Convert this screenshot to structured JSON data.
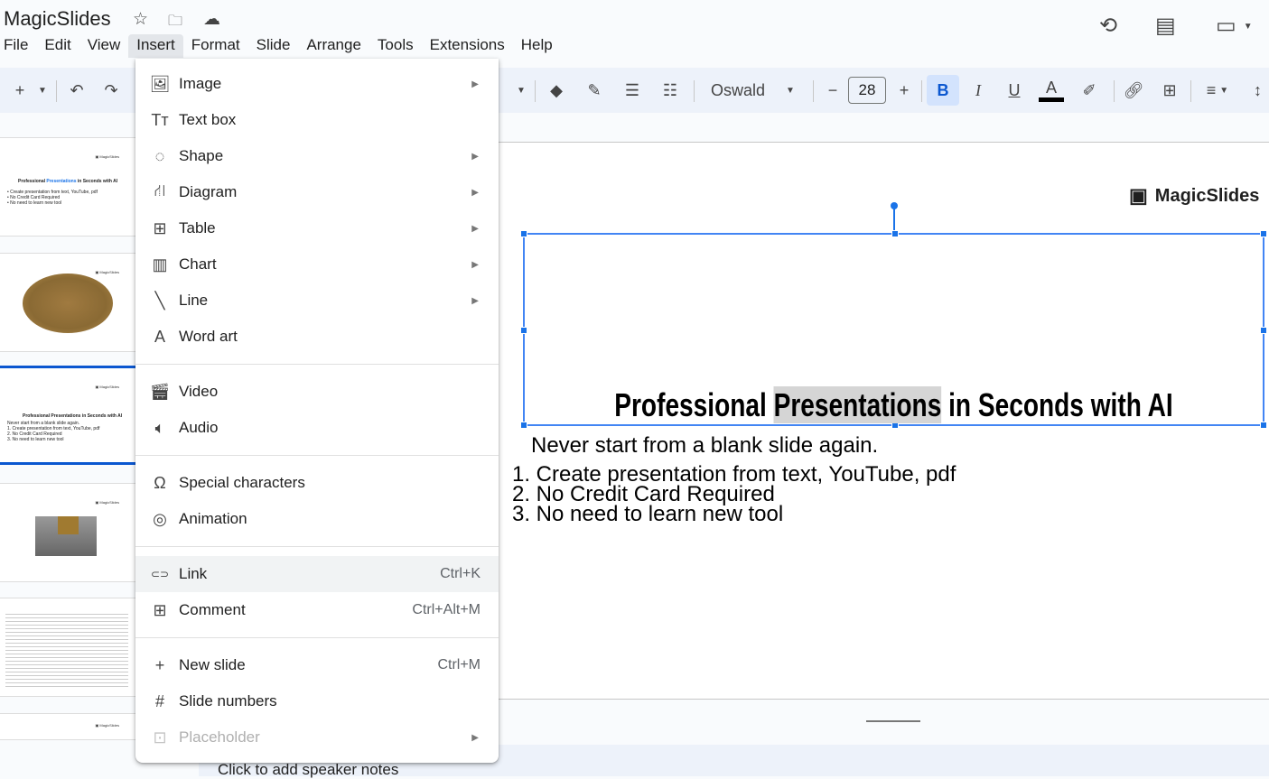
{
  "app": {
    "title": "MagicSlides",
    "star_icon": "star-icon",
    "move_icon": "folder-move-icon",
    "cloud_icon": "cloud-saved-icon"
  },
  "menubar": [
    "File",
    "Edit",
    "View",
    "Insert",
    "Format",
    "Slide",
    "Arrange",
    "Tools",
    "Extensions",
    "Help"
  ],
  "toolbar": {
    "font": "Oswald",
    "font_size": "28",
    "bold": "B",
    "italic": "I",
    "underline": "U",
    "text_color": "A"
  },
  "insert_menu": {
    "groups": [
      [
        {
          "label": "Image",
          "icon": "image-icon",
          "submenu": true
        },
        {
          "label": "Text box",
          "icon": "text-box-icon"
        },
        {
          "label": "Shape",
          "icon": "shape-icon",
          "submenu": true
        },
        {
          "label": "Diagram",
          "icon": "diagram-icon",
          "submenu": true
        },
        {
          "label": "Table",
          "icon": "table-icon",
          "submenu": true
        },
        {
          "label": "Chart",
          "icon": "chart-icon",
          "submenu": true
        },
        {
          "label": "Line",
          "icon": "line-icon",
          "submenu": true
        },
        {
          "label": "Word art",
          "icon": "word-art-icon"
        }
      ],
      [
        {
          "label": "Video",
          "icon": "video-icon"
        },
        {
          "label": "Audio",
          "icon": "audio-icon"
        }
      ],
      [
        {
          "label": "Special characters",
          "icon": "omega-icon"
        },
        {
          "label": "Animation",
          "icon": "animation-icon"
        }
      ],
      [
        {
          "label": "Link",
          "icon": "link-icon",
          "shortcut": "Ctrl+K"
        },
        {
          "label": "Comment",
          "icon": "comment-icon",
          "shortcut": "Ctrl+Alt+M"
        }
      ],
      [
        {
          "label": "New slide",
          "icon": "plus-icon",
          "shortcut": "Ctrl+M"
        },
        {
          "label": "Slide numbers",
          "icon": "hash-icon"
        },
        {
          "label": "Placeholder",
          "icon": "placeholder-icon",
          "submenu": true,
          "disabled": true
        }
      ]
    ]
  },
  "slide": {
    "logo": "MagicSlides",
    "title_pre": "Professional ",
    "title_hl": "Presentations",
    "title_post": " in Seconds with AI",
    "subtitle": "Never start from a blank slide again.",
    "list": [
      "1. Create presentation from text, YouTube, pdf",
      "2. No Credit Card Required",
      "3. No need to learn new tool"
    ]
  },
  "notes": {
    "placeholder": "Click to add speaker notes"
  },
  "colors": {
    "accent": "#0b57d0",
    "selection": "#4285f4",
    "toolbar_bg": "#edf2fa"
  }
}
